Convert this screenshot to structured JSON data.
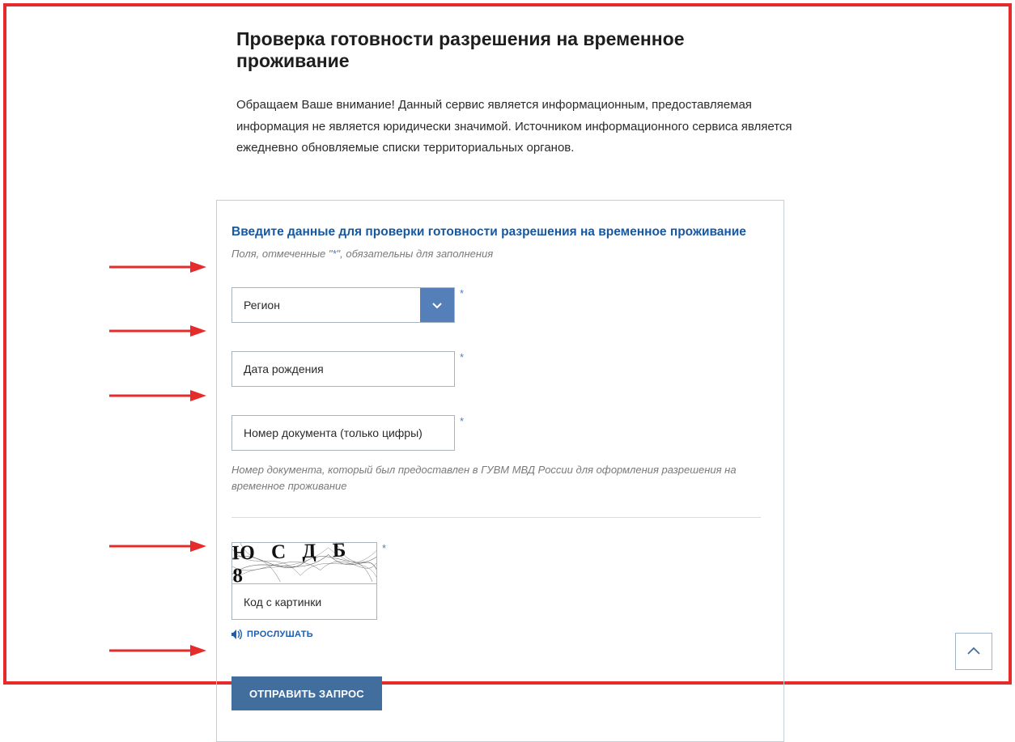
{
  "page": {
    "title": "Проверка готовности разрешения на временное проживание",
    "description": "Обращаем Ваше внимание! Данный сервис является информационным, предоставляемая информация не является юридически значимой. Источником информационного сервиса является ежедневно обновляемые списки территориальных органов."
  },
  "form": {
    "heading": "Введите данные для проверки готовности разрешения на временное проживание",
    "subnote_a": "Поля, отмеченные \"",
    "subnote_b": "\", обязательны для заполнения",
    "star": "*",
    "region": {
      "placeholder": "Регион"
    },
    "dob": {
      "placeholder": "Дата рождения"
    },
    "docnum": {
      "placeholder": "Номер документа (только цифры)",
      "hint": "Номер документа, который был предоставлен в ГУВМ МВД России для оформления разрешения на временное проживание"
    },
    "captcha": {
      "value": "Ю С Д Б 8",
      "input_placeholder": "Код с картинки",
      "listen": "ПРОСЛУШАТЬ"
    },
    "submit": "ОТПРАВИТЬ ЗАПРОС"
  }
}
